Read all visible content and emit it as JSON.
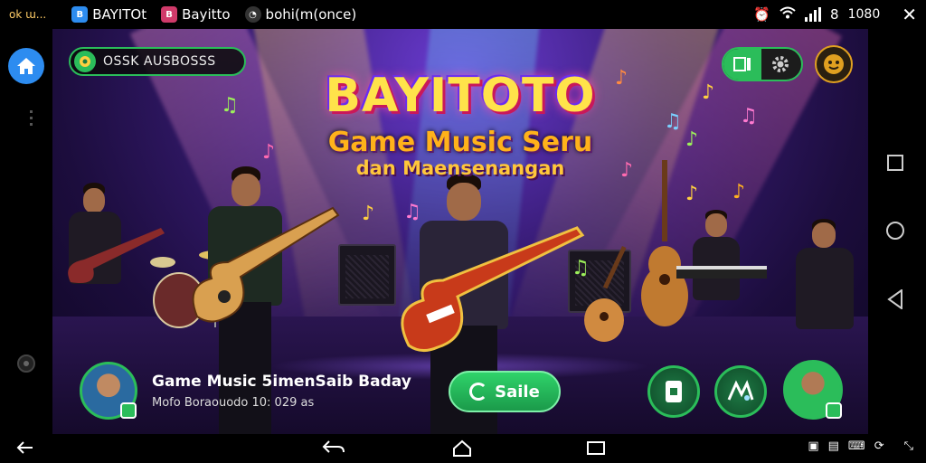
{
  "status_bar": {
    "left_label": "ok ɯ...",
    "apps": [
      {
        "badge_color": "#2d8cf0",
        "label": "BAYITOt"
      },
      {
        "badge_color": "#d03a6a",
        "label": "Bayitto"
      },
      {
        "badge_color": "#555555",
        "label": "bohi(m(once)"
      }
    ],
    "indicators": [
      "8",
      "1080"
    ]
  },
  "game": {
    "title": "BAYITOTO",
    "subtitle": "Game Music Seru",
    "subtitle2": "dan Maensenangan",
    "info_label": "OSSK AUSBOSSS",
    "now_playing": {
      "title": "Game Music 5imenSaib Baday",
      "meta": "Mofo Boraouodo 10: 029 as"
    },
    "play_label": "Saile"
  },
  "colors": {
    "accent": "#2bbd5a",
    "title": "#ffe34a",
    "subtitle": "#ffb21a"
  },
  "icons": {
    "home": "home-icon",
    "settings": "gear-icon",
    "back": "back-icon"
  }
}
